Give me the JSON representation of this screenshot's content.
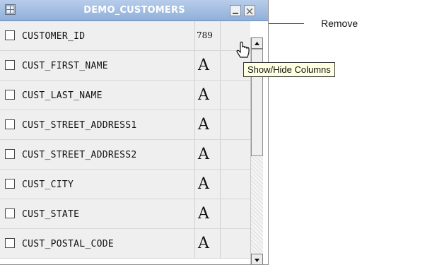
{
  "panel": {
    "title": "DEMO_CUSTOMERS",
    "header_color": "#9fbce2",
    "columns": [
      {
        "name": "CUSTOMER_ID",
        "type_icon": "789"
      },
      {
        "name": "CUST_FIRST_NAME",
        "type_icon": "A"
      },
      {
        "name": "CUST_LAST_NAME",
        "type_icon": "A"
      },
      {
        "name": "CUST_STREET_ADDRESS1",
        "type_icon": "A"
      },
      {
        "name": "CUST_STREET_ADDRESS2",
        "type_icon": "A"
      },
      {
        "name": "CUST_CITY",
        "type_icon": "A"
      },
      {
        "name": "CUST_STATE",
        "type_icon": "A"
      },
      {
        "name": "CUST_POSTAL_CODE",
        "type_icon": "A"
      }
    ]
  },
  "annotation": {
    "remove_label": "Remove"
  },
  "tooltip": {
    "text": "Show/Hide Columns"
  },
  "icons": {
    "header": "grid-icon",
    "minimize": "minimize-icon",
    "close": "close-icon",
    "cursor": "hand-cursor-icon"
  }
}
